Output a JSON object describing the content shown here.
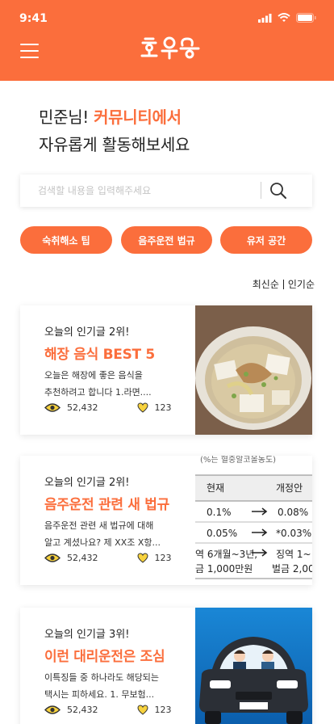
{
  "status": {
    "time": "9:41"
  },
  "greeting": {
    "name_prefix": "민준님! ",
    "highlight": "커뮤니티에서",
    "line2": "자유롭게 활동해보세요"
  },
  "search": {
    "placeholder": "검색할 내용을 입력해주세요"
  },
  "chips": [
    {
      "label": "숙취해소 팁"
    },
    {
      "label": "음주운전 법규"
    },
    {
      "label": "유저 공간"
    }
  ],
  "sort": {
    "latest": "최신순",
    "popular": "인기순"
  },
  "cards": [
    {
      "rank": "오늘의 인기글 2위!",
      "title": "해장 음식 BEST 5",
      "desc_line1": "오늘은 해장에 좋은 음식을",
      "desc_line2": "추천하려고 합니다 1.라면....",
      "views": "52,432",
      "likes": "123"
    },
    {
      "rank": "오늘의 인기글 2위!",
      "title": "음주운전 관련 새 법규",
      "desc_line1": "음주운전 관련 새 법규에 대해",
      "desc_line2": "알고 계셨나요? 제 XX조 X항...",
      "views": "52,432",
      "likes": "123",
      "table": {
        "header": "(%는 혈중알코올농도)",
        "col1": "현재",
        "col2": "개정안",
        "r1c1": "0.1%",
        "r1c2": "0.08%",
        "r2c1": "0.05%",
        "r2c2": "*0.03%",
        "r3c1a": "역 6개월~3년,",
        "r3c1b": "금 1,000만원",
        "r3c2a": "징역 1~",
        "r3c2b": "벌금 2,00"
      }
    },
    {
      "rank": "오늘의 인기글 3위!",
      "title": "이런 대리운전은 조심",
      "desc_line1": "이특징들 중 하나라도 해당되는",
      "desc_line2": "택시는 피하세요. 1. 무보험...",
      "views": "52,432",
      "likes": "123"
    }
  ],
  "colors": {
    "accent": "#fb6e3c",
    "like": "#f7d23e"
  },
  "icons": [
    "hamburger-menu-icon",
    "search-icon",
    "eye-icon",
    "heart-icon",
    "signal-icon",
    "wifi-icon",
    "battery-icon"
  ]
}
